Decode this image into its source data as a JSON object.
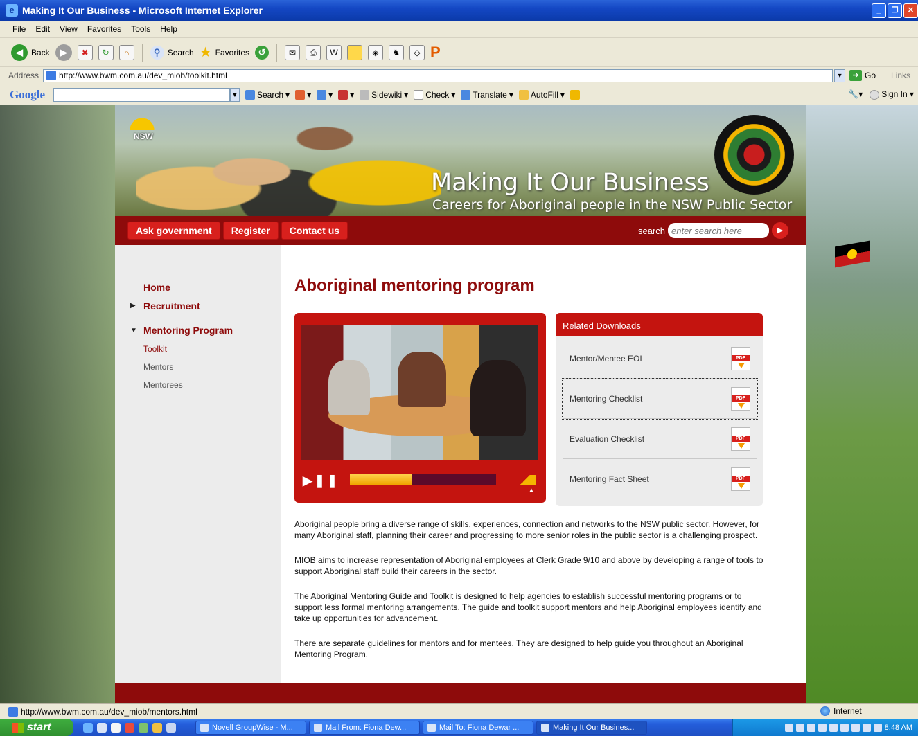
{
  "window": {
    "title": "Making It Our Business - Microsoft Internet Explorer"
  },
  "menu": [
    "File",
    "Edit",
    "View",
    "Favorites",
    "Tools",
    "Help"
  ],
  "toolbar": {
    "back": "Back",
    "search": "Search",
    "favorites": "Favorites"
  },
  "address": {
    "label": "Address",
    "url": "http://www.bwm.com.au/dev_miob/toolkit.html",
    "go": "Go",
    "links": "Links"
  },
  "google": {
    "logo": "Google",
    "search": "Search",
    "sidewiki": "Sidewiki",
    "check": "Check",
    "translate": "Translate",
    "autofill": "AutoFill",
    "signin": "Sign In"
  },
  "site": {
    "nsw": "NSW",
    "title": "Making It Our Business",
    "subtitle": "Careers for Aboriginal people in the NSW Public Sector",
    "nav": [
      "Ask government",
      "Register",
      "Contact us"
    ],
    "search_label": "search",
    "search_placeholder": "enter search here"
  },
  "sidebar": {
    "home": "Home",
    "recruitment": "Recruitment",
    "mentoring": "Mentoring Program",
    "sub": [
      "Toolkit",
      "Mentors",
      "Mentorees"
    ]
  },
  "main": {
    "title": "Aboriginal mentoring program",
    "video_progress": 0.42,
    "downloads_title": "Related Downloads",
    "downloads": [
      "Mentor/Mentee EOI",
      "Mentoring Checklist",
      "Evaluation Checklist",
      "Mentoring Fact Sheet"
    ],
    "pdf_label": "PDF",
    "paragraphs": [
      "Aboriginal people bring a diverse range of skills, experiences, connection and networks to the NSW public sector. However, for many Aboriginal staff, planning their career and progressing to more senior roles in the public sector is a challenging prospect.",
      "MIOB aims to increase representation of Aboriginal employees at Clerk Grade 9/10 and above by developing a range of tools to support Aboriginal staff build their careers in the sector.",
      "The Aboriginal Mentoring Guide and Toolkit is designed to help agencies to establish successful mentoring programs or to support less formal mentoring arrangements. The guide and toolkit support mentors and help Aboriginal employees identify and take up opportunities for advancement.",
      "There are separate guidelines for mentors and for mentees. They are designed to help guide you throughout an Aboriginal Mentoring Program."
    ]
  },
  "status": {
    "url": "http://www.bwm.com.au/dev_miob/mentors.html",
    "zone": "Internet"
  },
  "taskbar": {
    "start": "start",
    "tasks": [
      "Novell GroupWise - M...",
      "Mail From: Fiona Dew...",
      "Mail To: Fiona Dewar ...",
      "Making It Our Busines..."
    ],
    "clock": "8:48 AM"
  }
}
